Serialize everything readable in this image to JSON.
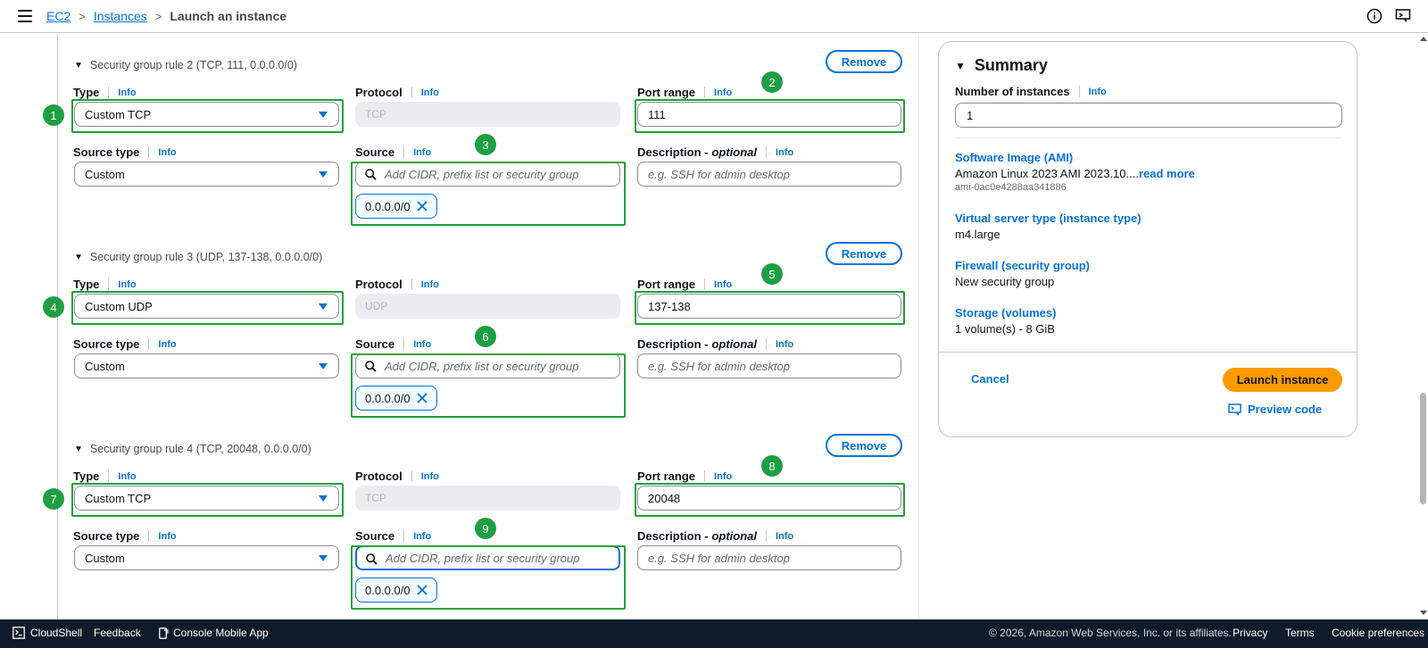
{
  "breadcrumb": {
    "ec2": "EC2",
    "instances": "Instances",
    "current": "Launch an instance"
  },
  "rules": [
    {
      "title": "Security group rule 2 (TCP, 111, 0.0.0.0/0)",
      "type": "Custom TCP",
      "protocol": "TCP",
      "port": "111",
      "source_type": "Custom",
      "token": "0.0.0.0/0"
    },
    {
      "title": "Security group rule 3 (UDP, 137-138, 0.0.0.0/0)",
      "type": "Custom UDP",
      "protocol": "UDP",
      "port": "137-138",
      "source_type": "Custom",
      "token": "0.0.0.0/0"
    },
    {
      "title": "Security group rule 4 (TCP, 20048, 0.0.0.0/0)",
      "type": "Custom TCP",
      "protocol": "TCP",
      "port": "20048",
      "source_type": "Custom",
      "token": "0.0.0.0/0"
    }
  ],
  "labels": {
    "remove": "Remove",
    "type": "Type",
    "protocol": "Protocol",
    "port_range": "Port range",
    "source_type": "Source type",
    "source": "Source",
    "description": "Description -",
    "optional": "optional",
    "info": "Info"
  },
  "placeholders": {
    "source": "Add CIDR, prefix list or security group",
    "description": "e.g. SSH for admin desktop"
  },
  "badges": [
    "1",
    "2",
    "3",
    "4",
    "5",
    "6",
    "7",
    "8",
    "9"
  ],
  "summary": {
    "title": "Summary",
    "num_label": "Number of instances",
    "num_value": "1",
    "ami_label": "Software Image (AMI)",
    "ami_value": "Amazon Linux 2023 AMI 2023.10....",
    "ami_more": "read more",
    "ami_id": "ami-0ac0e4288aa341886",
    "type_label": "Virtual server type (instance type)",
    "type_value": "m4.large",
    "firewall_label": "Firewall (security group)",
    "firewall_value": "New security group",
    "storage_label": "Storage (volumes)",
    "storage_value": "1 volume(s) - 8 GiB",
    "cancel": "Cancel",
    "launch": "Launch instance",
    "preview": "Preview code"
  },
  "footer": {
    "cloudshell": "CloudShell",
    "feedback": "Feedback",
    "mobile": "Console Mobile App",
    "copyright": "© 2026, Amazon Web Services, Inc. or its affiliates.",
    "privacy": "Privacy",
    "terms": "Terms",
    "cookies": "Cookie preferences"
  },
  "colors": {
    "accent": "#0972d3",
    "highlight": "#1aa33a",
    "launch": "#ff9900",
    "footer_bg": "#0f1b2a"
  }
}
